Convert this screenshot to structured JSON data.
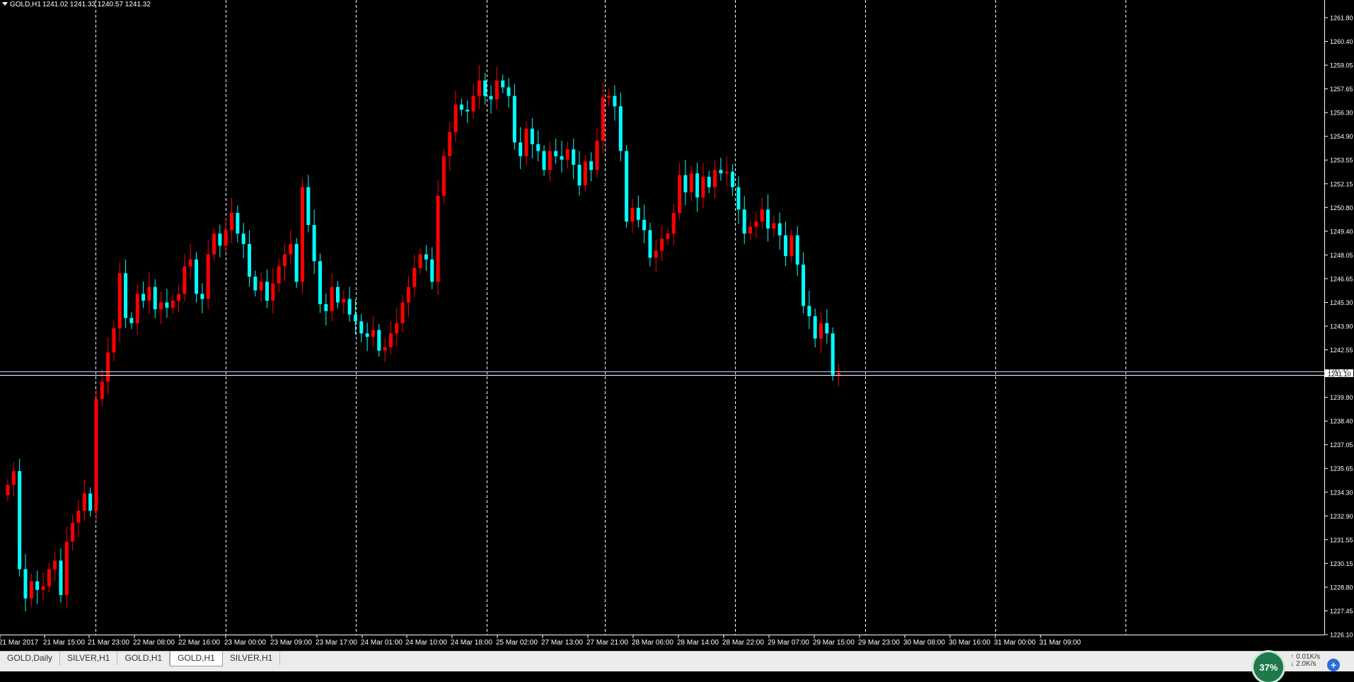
{
  "header": {
    "symbol": "GOLD,H1",
    "ohlc": "1241.02 1241.33 1240.57 1241.32"
  },
  "chart_data": {
    "type": "candlestick",
    "symbol": "GOLD,H1",
    "price_axis": {
      "ymin": 1226.1,
      "ymax": 1262.4,
      "ticks": [
        "1261.80",
        "1260.40",
        "1259.05",
        "1257.65",
        "1256.30",
        "1254.90",
        "1253.55",
        "1252.15",
        "1250.80",
        "1249.40",
        "1248.05",
        "1246.65",
        "1245.30",
        "1243.90",
        "1242.55",
        "1241.10",
        "1239.80",
        "1238.40",
        "1237.05",
        "1235.65",
        "1234.30",
        "1232.90",
        "1231.55",
        "1230.15",
        "1228.80",
        "1227.45",
        "1226.10"
      ],
      "current_price_label": "1241.10",
      "hidden_price_label": "1241.32"
    },
    "time_axis": [
      "21 Mar 2017",
      "21 Mar 15:00",
      "21 Mar 23:00",
      "22 Mar 08:00",
      "22 Mar 16:00",
      "23 Mar 00:00",
      "23 Mar 09:00",
      "23 Mar 17:00",
      "24 Mar 01:00",
      "24 Mar 10:00",
      "24 Mar 18:00",
      "25 Mar 02:00",
      "27 Mar 13:00",
      "27 Mar 21:00",
      "28 Mar 06:00",
      "28 Mar 14:00",
      "28 Mar 22:00",
      "29 Mar 07:00",
      "29 Mar 15:00",
      "29 Mar 23:00",
      "30 Mar 08:00",
      "30 Mar 16:00",
      "31 Mar 00:00",
      "31 Mar 09:00"
    ],
    "colors": {
      "up": "#ff0000",
      "down": "#00ffff",
      "grid": "#ffffff",
      "axis": "#ffffff",
      "background": "#000000"
    },
    "grid": "vertical-dashed",
    "close_path": [
      [
        0,
        1234.8
      ],
      [
        1,
        1235.6
      ],
      [
        2,
        1229.9
      ],
      [
        3,
        1228.2
      ],
      [
        4,
        1229.2
      ],
      [
        5,
        1228.7
      ],
      [
        6,
        1228.9
      ],
      [
        7,
        1229.9
      ],
      [
        8,
        1230.4
      ],
      [
        9,
        1228.4
      ],
      [
        10,
        1231.5
      ],
      [
        11,
        1232.6
      ],
      [
        12,
        1233.3
      ],
      [
        13,
        1234.3
      ],
      [
        14,
        1233.3
      ],
      [
        15,
        1239.8
      ],
      [
        16,
        1240.8
      ],
      [
        17,
        1242.5
      ],
      [
        18,
        1243.9
      ],
      [
        19,
        1247.1
      ],
      [
        20,
        1244.5
      ],
      [
        21,
        1244.2
      ],
      [
        22,
        1245.9
      ],
      [
        23,
        1245.5
      ],
      [
        24,
        1246.3
      ],
      [
        25,
        1245.0
      ],
      [
        26,
        1245.4
      ],
      [
        27,
        1245.1
      ],
      [
        28,
        1245.5
      ],
      [
        29,
        1245.9
      ],
      [
        30,
        1247.5
      ],
      [
        31,
        1247.9
      ],
      [
        32,
        1245.9
      ],
      [
        33,
        1245.6
      ],
      [
        34,
        1248.2
      ],
      [
        35,
        1249.4
      ],
      [
        36,
        1248.7
      ],
      [
        37,
        1249.6
      ],
      [
        38,
        1250.6
      ],
      [
        39,
        1249.4
      ],
      [
        40,
        1248.8
      ],
      [
        41,
        1246.9
      ],
      [
        42,
        1246.1
      ],
      [
        43,
        1246.6
      ],
      [
        44,
        1245.5
      ],
      [
        45,
        1246.5
      ],
      [
        46,
        1247.5
      ],
      [
        47,
        1248.2
      ],
      [
        48,
        1248.8
      ],
      [
        49,
        1246.6
      ],
      [
        50,
        1252.1
      ],
      [
        51,
        1249.9
      ],
      [
        52,
        1247.8
      ],
      [
        53,
        1245.3
      ],
      [
        54,
        1244.9
      ],
      [
        55,
        1246.3
      ],
      [
        56,
        1245.4
      ],
      [
        57,
        1245.6
      ],
      [
        58,
        1244.7
      ],
      [
        59,
        1244.3
      ],
      [
        60,
        1243.6
      ],
      [
        61,
        1243.4
      ],
      [
        62,
        1243.8
      ],
      [
        63,
        1242.6
      ],
      [
        64,
        1242.8
      ],
      [
        65,
        1243.6
      ],
      [
        66,
        1244.2
      ],
      [
        67,
        1245.4
      ],
      [
        68,
        1246.3
      ],
      [
        69,
        1247.4
      ],
      [
        70,
        1248.2
      ],
      [
        71,
        1247.9
      ],
      [
        72,
        1246.6
      ],
      [
        73,
        1251.6
      ],
      [
        74,
        1253.9
      ],
      [
        75,
        1255.3
      ],
      [
        76,
        1256.9
      ],
      [
        77,
        1256.6
      ],
      [
        78,
        1256.5
      ],
      [
        79,
        1257.4
      ],
      [
        80,
        1258.3
      ],
      [
        81,
        1257.4
      ],
      [
        82,
        1257.2
      ],
      [
        83,
        1258.3
      ],
      [
        84,
        1257.9
      ],
      [
        85,
        1257.4
      ],
      [
        86,
        1254.7
      ],
      [
        87,
        1253.9
      ],
      [
        88,
        1255.5
      ],
      [
        89,
        1254.6
      ],
      [
        90,
        1254.2
      ],
      [
        91,
        1253.1
      ],
      [
        92,
        1254.2
      ],
      [
        93,
        1253.9
      ],
      [
        94,
        1253.7
      ],
      [
        95,
        1254.3
      ],
      [
        96,
        1253.4
      ],
      [
        97,
        1252.2
      ],
      [
        98,
        1253.6
      ],
      [
        99,
        1253.1
      ],
      [
        100,
        1254.8
      ],
      [
        101,
        1257.3
      ],
      [
        102,
        1257.4
      ],
      [
        103,
        1256.8
      ],
      [
        104,
        1254.2
      ],
      [
        105,
        1250.1
      ],
      [
        106,
        1250.9
      ],
      [
        107,
        1250.2
      ],
      [
        108,
        1249.6
      ],
      [
        109,
        1248.0
      ],
      [
        110,
        1248.4
      ],
      [
        111,
        1249.1
      ],
      [
        112,
        1249.4
      ],
      [
        113,
        1250.6
      ],
      [
        114,
        1252.8
      ],
      [
        115,
        1251.8
      ],
      [
        116,
        1252.9
      ],
      [
        117,
        1251.5
      ],
      [
        118,
        1252.7
      ],
      [
        119,
        1252.1
      ],
      [
        120,
        1253.1
      ],
      [
        121,
        1252.9
      ],
      [
        122,
        1253.0
      ],
      [
        123,
        1252.1
      ],
      [
        124,
        1250.8
      ],
      [
        125,
        1249.4
      ],
      [
        126,
        1249.8
      ],
      [
        127,
        1250.1
      ],
      [
        128,
        1250.8
      ],
      [
        129,
        1249.7
      ],
      [
        130,
        1250.0
      ],
      [
        131,
        1249.3
      ],
      [
        132,
        1248.1
      ],
      [
        133,
        1249.3
      ],
      [
        134,
        1247.6
      ],
      [
        135,
        1245.2
      ],
      [
        136,
        1244.6
      ],
      [
        137,
        1243.3
      ],
      [
        138,
        1244.2
      ],
      [
        139,
        1243.6
      ],
      [
        140,
        1241.2
      ],
      [
        141,
        1241.3
      ]
    ]
  },
  "tabs": [
    {
      "label": "GOLD,Daily"
    },
    {
      "label": "SILVER,H1"
    },
    {
      "label": "GOLD,H1"
    },
    {
      "label": "GOLD,H1"
    },
    {
      "label": "SILVER,H1"
    }
  ],
  "status": {
    "percent": "37%",
    "upload": "0.01K/s",
    "download": "2.0K/s",
    "add_label": "+"
  }
}
